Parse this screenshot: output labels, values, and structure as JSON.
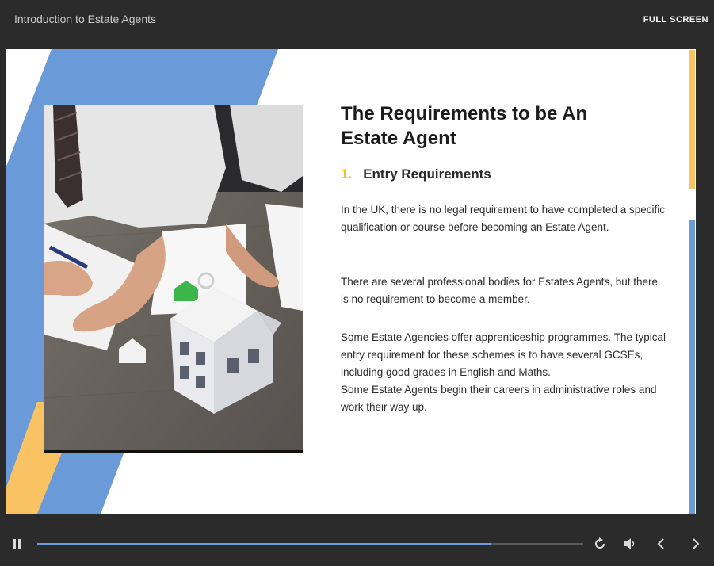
{
  "header": {
    "title": "Introduction to Estate Agents",
    "fullscreen_label": "FULL SCREEN"
  },
  "slide": {
    "heading": "The Requirements to be An Estate Agent",
    "subheading_number": "1.",
    "subheading": "Entry Requirements",
    "paragraph1": "In the UK, there is no legal requirement to have completed a specific qualification or course before becoming an Estate Agent.",
    "paragraph2": "There are several professional bodies for Estates Agents, but there is no requirement to become a member.",
    "paragraph3_line1": "Some Estate Agencies offer apprenticeship programmes. The typical entry requirement for these schemes is to have several GCSEs, including good grades in English and Maths.",
    "paragraph3_line2": "Some Estate Agents begin their careers in administrative roles and work their way up."
  },
  "player": {
    "progress": 0.83,
    "icons": [
      "pause-icon",
      "replay-icon",
      "volume-icon",
      "previous-icon",
      "next-icon"
    ]
  },
  "colors": {
    "accent_blue": "#6a9bd8",
    "accent_yellow": "#f9c262",
    "number_yellow": "#f2be33",
    "bar_background": "#2b2b2b"
  }
}
